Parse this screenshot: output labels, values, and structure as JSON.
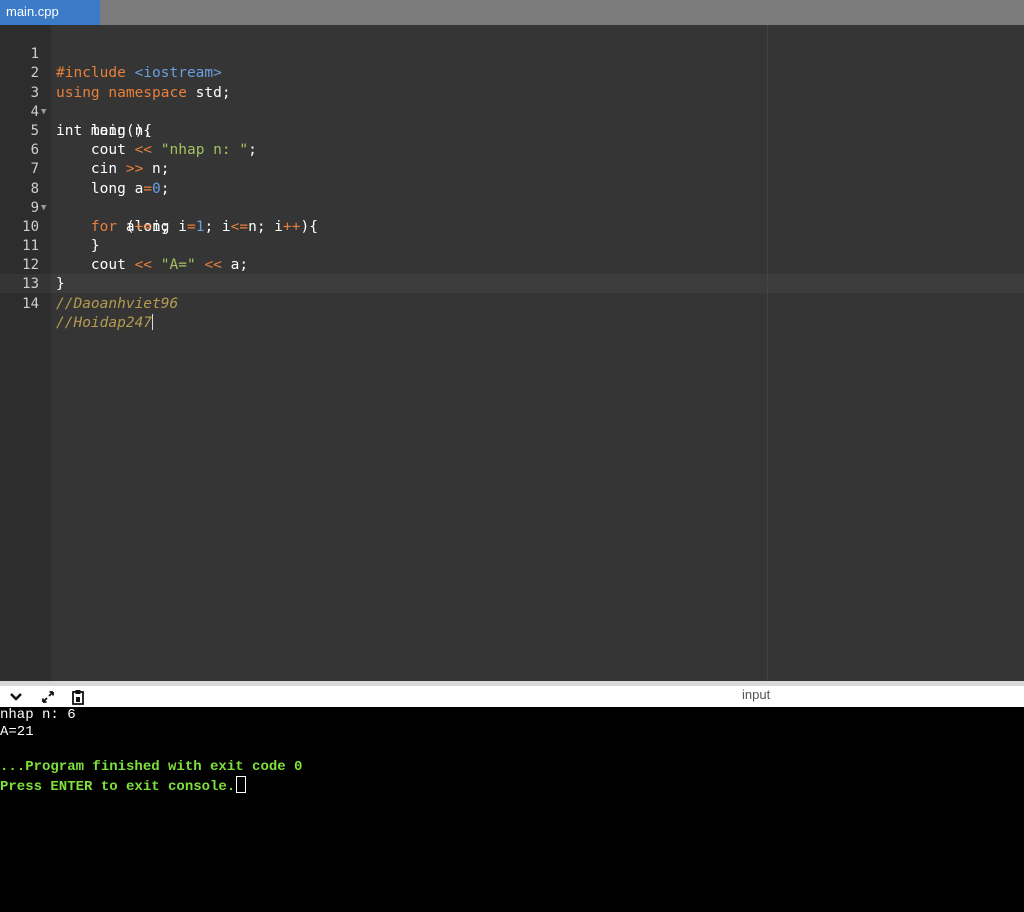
{
  "tab": {
    "label": "main.cpp"
  },
  "editor": {
    "lines": [
      {
        "n": "1"
      },
      {
        "n": "2"
      },
      {
        "n": "3"
      },
      {
        "n": "4"
      },
      {
        "n": "5"
      },
      {
        "n": "6"
      },
      {
        "n": "7"
      },
      {
        "n": "8"
      },
      {
        "n": "9"
      },
      {
        "n": "10"
      },
      {
        "n": "11"
      },
      {
        "n": "12"
      },
      {
        "n": "13"
      },
      {
        "n": "14"
      }
    ],
    "code": {
      "l1_pp": "#include ",
      "l1_inc": "<iostream>",
      "l2_kw": "using namespace",
      "l2_rest": " std;",
      "l3": "int main(){",
      "l4": "    long n;",
      "l5_a": "    cout ",
      "l5_op": "<<",
      "l5_b": " ",
      "l5_str": "\"nhap n: \"",
      "l5_c": ";",
      "l6_a": "    cin ",
      "l6_op": ">>",
      "l6_b": " n;",
      "l7_a": "    long a",
      "l7_op": "=",
      "l7_num": "0",
      "l7_b": ";",
      "l8_a": "    ",
      "l8_kw": "for",
      "l8_b": " (long i",
      "l8_op1": "=",
      "l8_num": "1",
      "l8_c": "; i",
      "l8_op2": "<=",
      "l8_d": "n; i",
      "l8_op3": "++",
      "l8_e": "){",
      "l9_a": "        a",
      "l9_op": "+=",
      "l9_b": "i;",
      "l10": "    }",
      "l11_a": "    cout ",
      "l11_op1": "<<",
      "l11_b": " ",
      "l11_str": "\"A=\"",
      "l11_c": " ",
      "l11_op2": "<<",
      "l11_d": " a;",
      "l12": "}",
      "l13": "//Daoanhviet96",
      "l14": "//Hoidap247"
    }
  },
  "console_bar": {
    "collapse_icon": "chevron-down-icon",
    "expand_icon": "expand-icon",
    "copy_icon": "clipboard-icon",
    "input_label": "input"
  },
  "console": {
    "out1": "nhap n: 6",
    "out2": "A=21",
    "blank": "",
    "finished": "...Program finished with exit code 0",
    "press": "Press ENTER to exit console."
  }
}
